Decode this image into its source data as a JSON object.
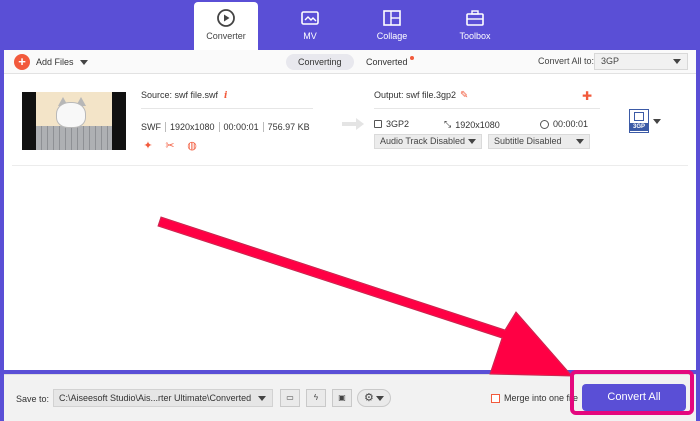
{
  "tabs": [
    {
      "label": "Converter",
      "icon": "converter-icon",
      "active": true
    },
    {
      "label": "MV",
      "icon": "mv-icon",
      "active": false
    },
    {
      "label": "Collage",
      "icon": "collage-icon",
      "active": false
    },
    {
      "label": "Toolbox",
      "icon": "toolbox-icon",
      "active": false
    }
  ],
  "toolbar": {
    "add_files": "Add Files",
    "converting": "Converting",
    "converted": "Converted",
    "convert_all_to": "Convert All to:",
    "format": "3GP"
  },
  "file": {
    "source": "Source: swf file.swf",
    "format": "SWF",
    "resolution": "1920x1080",
    "duration": "00:00:01",
    "size": "756.97 KB",
    "output": "Output: swf file.3gp2",
    "out_format": "3GP2",
    "out_resolution": "1920x1080",
    "out_duration": "00:00:01",
    "audio_track": "Audio Track Disabled",
    "subtitle": "Subtitle Disabled",
    "format_badge": "3GP"
  },
  "bottom": {
    "save_to": "Save to:",
    "path": "C:\\Aiseesoft Studio\\Ais...rter Ultimate\\Converted",
    "merge": "Merge into one file",
    "convert_all": "Convert All"
  },
  "colors": {
    "accent": "#5a4fd6",
    "orange": "#f25a3c",
    "highlight": "#e4087e",
    "arrow": "#ff0044"
  }
}
